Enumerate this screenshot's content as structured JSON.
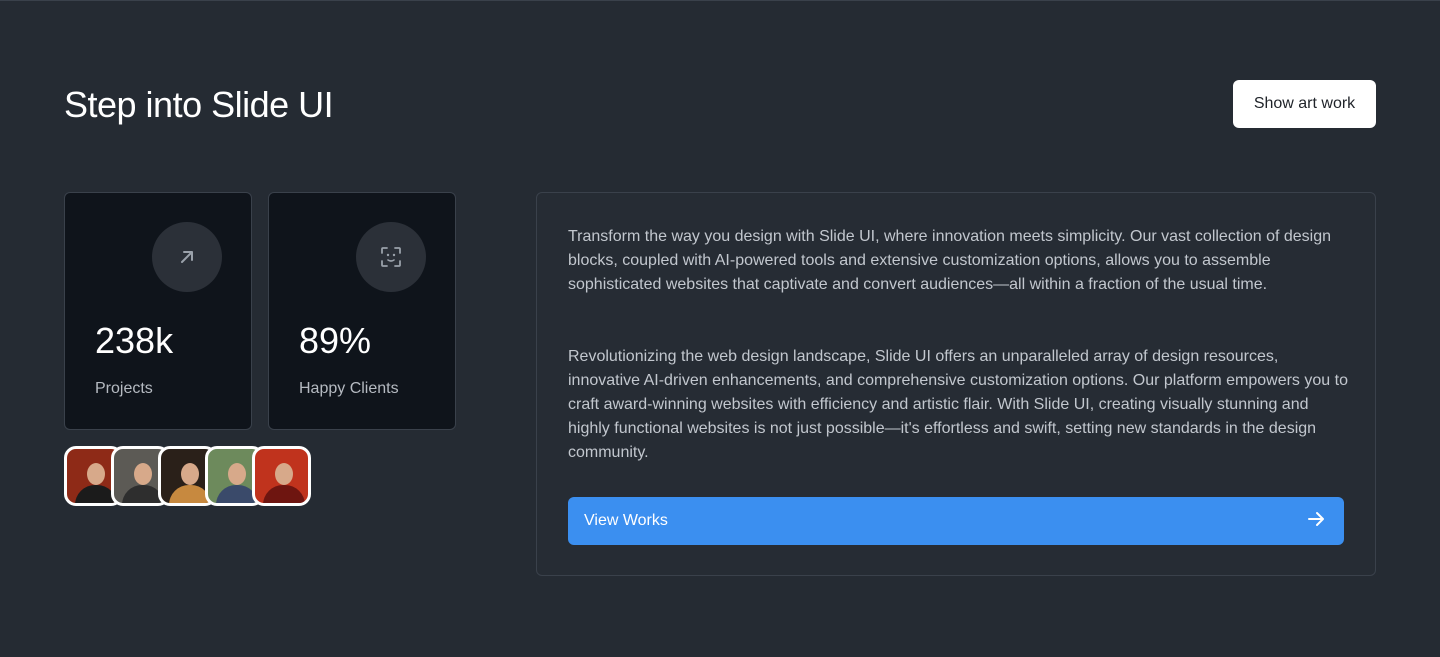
{
  "header": {
    "title": "Step into Slide UI",
    "art_button_label": "Show art work"
  },
  "stats": [
    {
      "value": "238k",
      "label": "Projects",
      "icon": "arrow-up-right-icon"
    },
    {
      "value": "89%",
      "label": "Happy Clients",
      "icon": "face-scan-icon"
    }
  ],
  "avatars": [
    {
      "name": "avatar-1",
      "bg": "#8e2a17",
      "body": "#1b1b1b"
    },
    {
      "name": "avatar-2",
      "bg": "#5c5a55",
      "body": "#2e2e2e"
    },
    {
      "name": "avatar-3",
      "bg": "#2a2019",
      "body": "#c7893f"
    },
    {
      "name": "avatar-4",
      "bg": "#6d8a5c",
      "body": "#3a4a6a"
    },
    {
      "name": "avatar-5",
      "bg": "#c0331d",
      "body": "#6e1510"
    }
  ],
  "content": {
    "paragraph_1": "Transform the way you design with Slide UI, where innovation meets simplicity. Our vast collection of design blocks, coupled with AI-powered tools and extensive customization options, allows you to assemble sophisticated websites that captivate and convert audiences—all within a fraction of the usual time.",
    "paragraph_2": "Revolutionizing the web design landscape, Slide UI offers an unparalleled array of design resources, innovative AI-driven enhancements, and comprehensive customization options. Our platform empowers you to craft award-winning websites with efficiency and artistic flair. With Slide UI, creating visually stunning and highly functional websites is not just possible—it's effortless and swift, setting new standards in the design community.",
    "cta_label": "View Works",
    "cta_icon": "arrow-right-icon"
  },
  "colors": {
    "background": "#252b33",
    "card": "#0f141b",
    "accent": "#3b8ff0"
  }
}
